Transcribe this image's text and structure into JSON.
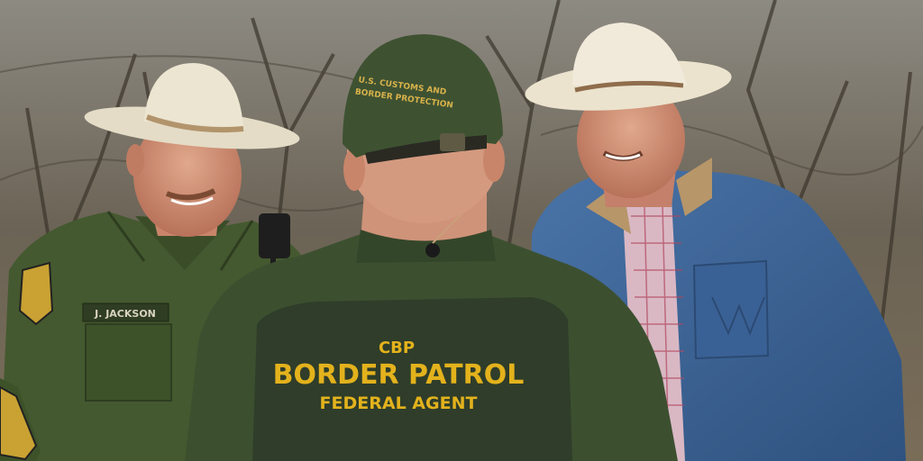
{
  "photo": {
    "vest": {
      "agency": "CBP",
      "title": "BORDER PATROL",
      "subtitle": "FEDERAL AGENT"
    },
    "name_tag": "J. JACKSON",
    "cap_text_line1": "U.S. CUSTOMS AND",
    "cap_text_line2": "BORDER PROTECTION"
  },
  "colors": {
    "uniform_green": "#3f5530",
    "vest_green": "#2f3d2a",
    "patch_gold": "#e3b21c",
    "denim": "#3d6495",
    "hat_cream": "#e9e2cc"
  }
}
